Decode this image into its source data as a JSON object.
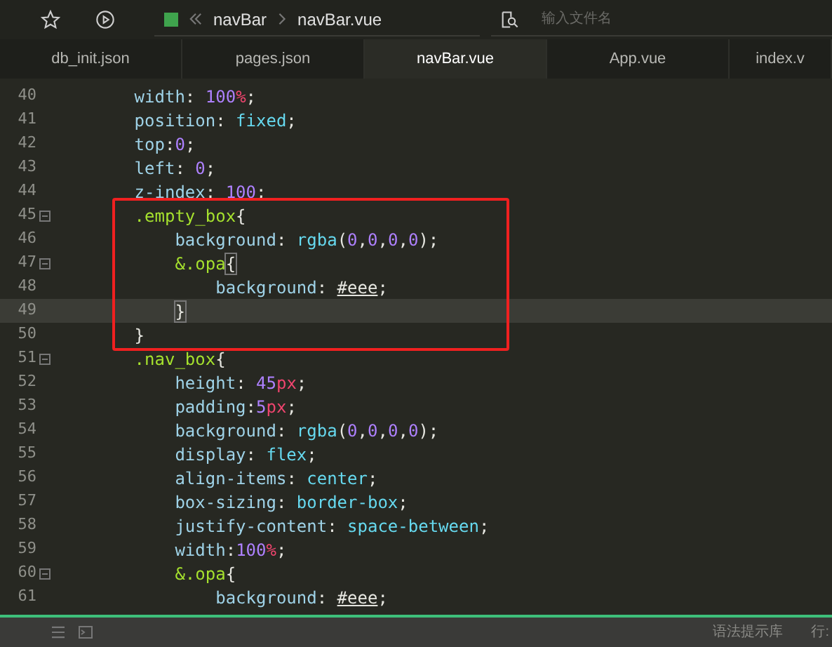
{
  "breadcrumb": {
    "items": [
      "navBar",
      "navBar.vue"
    ]
  },
  "file_search": {
    "placeholder": "输入文件名"
  },
  "tabs": [
    {
      "label": "db_init.json",
      "selected": false
    },
    {
      "label": "pages.json",
      "selected": false
    },
    {
      "label": "navBar.vue",
      "selected": true
    },
    {
      "label": "App.vue",
      "selected": false
    },
    {
      "label": "index.v",
      "selected": false
    }
  ],
  "code_blocks": [
    {
      "boxed": false,
      "lines": [
        {
          "number": "40",
          "fold": false,
          "current": false,
          "tokens": [
            {
              "text": "        width",
              "kind": "prop"
            },
            {
              "text": ": ",
              "kind": "punct"
            },
            {
              "text": "100",
              "kind": "num"
            },
            {
              "text": "%",
              "kind": "unit"
            },
            {
              "text": ";",
              "kind": "punct"
            }
          ]
        },
        {
          "number": "41",
          "fold": false,
          "current": false,
          "tokens": [
            {
              "text": "        position",
              "kind": "prop"
            },
            {
              "text": ": ",
              "kind": "punct"
            },
            {
              "text": "fixed",
              "kind": "value"
            },
            {
              "text": ";",
              "kind": "punct"
            }
          ]
        },
        {
          "number": "42",
          "fold": false,
          "current": false,
          "tokens": [
            {
              "text": "        top",
              "kind": "prop"
            },
            {
              "text": ":",
              "kind": "punct"
            },
            {
              "text": "0",
              "kind": "num"
            },
            {
              "text": ";",
              "kind": "punct"
            }
          ]
        },
        {
          "number": "43",
          "fold": false,
          "current": false,
          "tokens": [
            {
              "text": "        left",
              "kind": "prop"
            },
            {
              "text": ": ",
              "kind": "punct"
            },
            {
              "text": "0",
              "kind": "num"
            },
            {
              "text": ";",
              "kind": "punct"
            }
          ]
        },
        {
          "number": "44",
          "fold": false,
          "current": false,
          "tokens": [
            {
              "text": "        z-index",
              "kind": "prop"
            },
            {
              "text": ": ",
              "kind": "punct"
            },
            {
              "text": "100",
              "kind": "num"
            },
            {
              "text": ";",
              "kind": "punct"
            }
          ]
        }
      ]
    },
    {
      "boxed": true,
      "lines": [
        {
          "number": "45",
          "fold": true,
          "current": false,
          "tokens": [
            {
              "text": "        .empty_box",
              "kind": "selector"
            },
            {
              "text": "{",
              "kind": "punct"
            }
          ]
        },
        {
          "number": "46",
          "fold": false,
          "current": false,
          "tokens": [
            {
              "text": "            background",
              "kind": "prop"
            },
            {
              "text": ": ",
              "kind": "punct"
            },
            {
              "text": "rgba",
              "kind": "value"
            },
            {
              "text": "(",
              "kind": "punct"
            },
            {
              "text": "0",
              "kind": "num"
            },
            {
              "text": ",",
              "kind": "punct"
            },
            {
              "text": "0",
              "kind": "num"
            },
            {
              "text": ",",
              "kind": "punct"
            },
            {
              "text": "0",
              "kind": "num"
            },
            {
              "text": ",",
              "kind": "punct"
            },
            {
              "text": "0",
              "kind": "num"
            },
            {
              "text": ");",
              "kind": "punct"
            }
          ]
        },
        {
          "number": "47",
          "fold": true,
          "current": false,
          "tokens": [
            {
              "text": "            &.opa",
              "kind": "selector"
            },
            {
              "text": "{",
              "kind": "brace_match"
            }
          ]
        },
        {
          "number": "48",
          "fold": false,
          "current": false,
          "tokens": [
            {
              "text": "                background",
              "kind": "prop"
            },
            {
              "text": ": ",
              "kind": "punct"
            },
            {
              "text": "#eee",
              "kind": "hex"
            },
            {
              "text": ";",
              "kind": "punct"
            }
          ]
        },
        {
          "number": "49",
          "fold": false,
          "current": true,
          "tokens": [
            {
              "text": "            }",
              "kind": "brace_match"
            }
          ]
        },
        {
          "number": "50",
          "fold": false,
          "current": false,
          "tokens": [
            {
              "text": "        }",
              "kind": "punct"
            }
          ]
        }
      ]
    },
    {
      "boxed": false,
      "lines": [
        {
          "number": "51",
          "fold": true,
          "current": false,
          "tokens": [
            {
              "text": "        .nav_box",
              "kind": "selector"
            },
            {
              "text": "{",
              "kind": "punct"
            }
          ]
        },
        {
          "number": "52",
          "fold": false,
          "current": false,
          "tokens": [
            {
              "text": "            height",
              "kind": "prop"
            },
            {
              "text": ": ",
              "kind": "punct"
            },
            {
              "text": "45",
              "kind": "num"
            },
            {
              "text": "px",
              "kind": "unit"
            },
            {
              "text": ";",
              "kind": "punct"
            }
          ]
        },
        {
          "number": "53",
          "fold": false,
          "current": false,
          "tokens": [
            {
              "text": "            padding",
              "kind": "prop"
            },
            {
              "text": ":",
              "kind": "punct"
            },
            {
              "text": "5",
              "kind": "num"
            },
            {
              "text": "px",
              "kind": "unit"
            },
            {
              "text": ";",
              "kind": "punct"
            }
          ]
        },
        {
          "number": "54",
          "fold": false,
          "current": false,
          "tokens": [
            {
              "text": "            background",
              "kind": "prop"
            },
            {
              "text": ": ",
              "kind": "punct"
            },
            {
              "text": "rgba",
              "kind": "value"
            },
            {
              "text": "(",
              "kind": "punct"
            },
            {
              "text": "0",
              "kind": "num"
            },
            {
              "text": ",",
              "kind": "punct"
            },
            {
              "text": "0",
              "kind": "num"
            },
            {
              "text": ",",
              "kind": "punct"
            },
            {
              "text": "0",
              "kind": "num"
            },
            {
              "text": ",",
              "kind": "punct"
            },
            {
              "text": "0",
              "kind": "num"
            },
            {
              "text": ");",
              "kind": "punct"
            }
          ]
        },
        {
          "number": "55",
          "fold": false,
          "current": false,
          "tokens": [
            {
              "text": "            display",
              "kind": "prop"
            },
            {
              "text": ": ",
              "kind": "punct"
            },
            {
              "text": "flex",
              "kind": "value"
            },
            {
              "text": ";",
              "kind": "punct"
            }
          ]
        },
        {
          "number": "56",
          "fold": false,
          "current": false,
          "tokens": [
            {
              "text": "            align-items",
              "kind": "prop"
            },
            {
              "text": ": ",
              "kind": "punct"
            },
            {
              "text": "center",
              "kind": "value"
            },
            {
              "text": ";",
              "kind": "punct"
            }
          ]
        },
        {
          "number": "57",
          "fold": false,
          "current": false,
          "tokens": [
            {
              "text": "            box-sizing",
              "kind": "prop"
            },
            {
              "text": ": ",
              "kind": "punct"
            },
            {
              "text": "border-box",
              "kind": "value"
            },
            {
              "text": ";",
              "kind": "punct"
            }
          ]
        },
        {
          "number": "58",
          "fold": false,
          "current": false,
          "tokens": [
            {
              "text": "            justify-content",
              "kind": "prop"
            },
            {
              "text": ": ",
              "kind": "punct"
            },
            {
              "text": "space-between",
              "kind": "value"
            },
            {
              "text": ";",
              "kind": "punct"
            }
          ]
        },
        {
          "number": "59",
          "fold": false,
          "current": false,
          "tokens": [
            {
              "text": "            width",
              "kind": "prop"
            },
            {
              "text": ":",
              "kind": "punct"
            },
            {
              "text": "100",
              "kind": "num"
            },
            {
              "text": "%",
              "kind": "unit"
            },
            {
              "text": ";",
              "kind": "punct"
            }
          ]
        },
        {
          "number": "60",
          "fold": true,
          "current": false,
          "tokens": [
            {
              "text": "            &.opa",
              "kind": "selector"
            },
            {
              "text": "{",
              "kind": "punct"
            }
          ]
        },
        {
          "number": "61",
          "fold": false,
          "current": false,
          "tokens": [
            {
              "text": "                background",
              "kind": "prop"
            },
            {
              "text": ": ",
              "kind": "punct"
            },
            {
              "text": "#eee",
              "kind": "hex"
            },
            {
              "text": ";",
              "kind": "punct"
            }
          ]
        }
      ]
    }
  ],
  "status_bar": {
    "hint_library": "语法提示库",
    "position": "行:"
  }
}
